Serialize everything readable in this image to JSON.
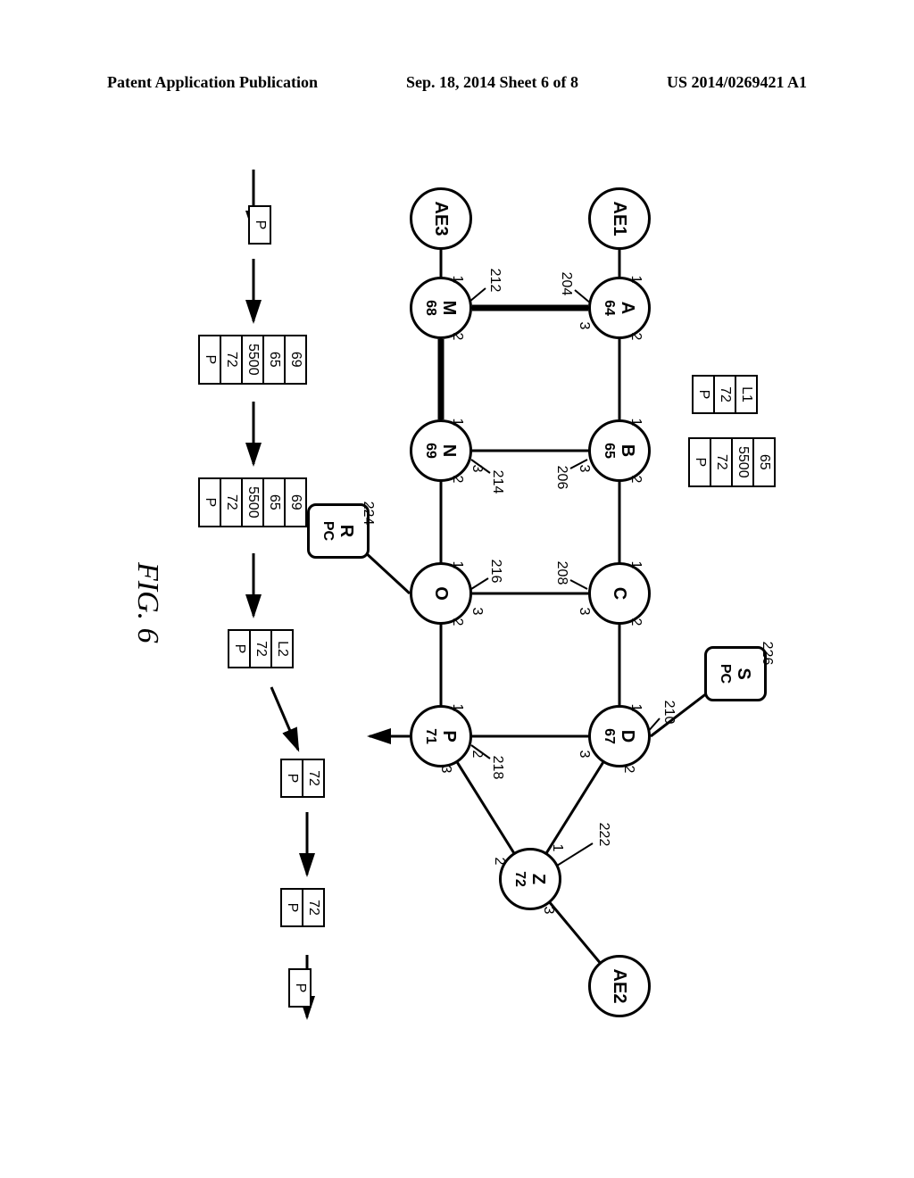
{
  "header": {
    "left": "Patent Application Publication",
    "center": "Sep. 18, 2014  Sheet 6 of 8",
    "right": "US 2014/0269421 A1"
  },
  "fig_label": "FIG. 6",
  "nodes": {
    "ae1": {
      "label": "AE1"
    },
    "ae2": {
      "label": "AE2"
    },
    "ae3": {
      "label": "AE3"
    },
    "a": {
      "label": "A",
      "val": "64"
    },
    "b": {
      "label": "B",
      "val": "65"
    },
    "c": {
      "label": "C"
    },
    "d": {
      "label": "D",
      "val": "67"
    },
    "m": {
      "label": "M",
      "val": "68"
    },
    "n": {
      "label": "N",
      "val": "69"
    },
    "o": {
      "label": "O"
    },
    "p": {
      "label": "P",
      "val": "71"
    },
    "z": {
      "label": "Z",
      "val": "72"
    },
    "s": {
      "label": "S",
      "sub": "PC"
    },
    "r": {
      "label": "R",
      "sub": "PC"
    }
  },
  "refs": {
    "r204": "204",
    "r206": "206",
    "r208": "208",
    "r210": "210",
    "r212": "212",
    "r214": "214",
    "r216": "216",
    "r218": "218",
    "r222": "222",
    "r224": "224",
    "r226": "226"
  },
  "ports": {
    "p1": "1",
    "p2": "2",
    "p3": "3"
  },
  "stacks": {
    "l1": {
      "cells": [
        "L1",
        "72",
        "P"
      ]
    },
    "s65": {
      "cells": [
        "65",
        "5500",
        "72",
        "P"
      ]
    },
    "s69a": {
      "cells": [
        "69",
        "65",
        "5500",
        "72",
        "P"
      ]
    },
    "s69b": {
      "cells": [
        "69",
        "65",
        "5500",
        "72",
        "P"
      ]
    },
    "l2": {
      "cells": [
        "L2",
        "72",
        "P"
      ]
    },
    "s72a": {
      "cells": [
        "72",
        "P"
      ]
    },
    "s72b": {
      "cells": [
        "72",
        "P"
      ]
    },
    "p1": {
      "cells": [
        "P"
      ]
    },
    "p2": {
      "cells": [
        "P"
      ]
    }
  }
}
